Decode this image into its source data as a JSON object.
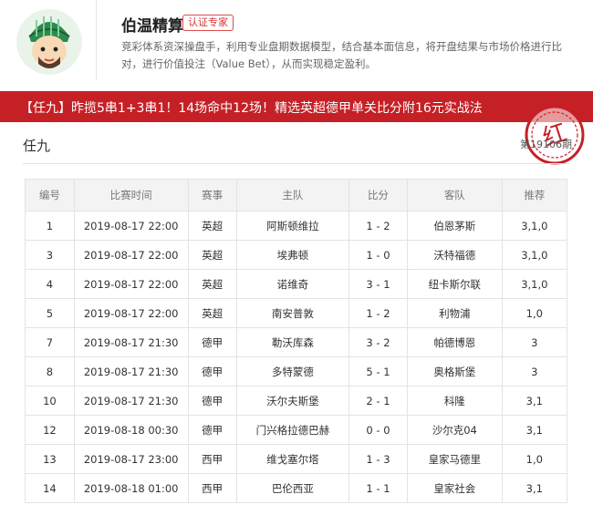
{
  "expert": {
    "name": "伯温精算",
    "badge": "认证专家",
    "description": "竞彩体系资深操盘手，利用专业盘期数据模型，结合基本面信息，将开盘结果与市场价格进行比对，进行价值投注（Value Bet），从而实现稳定盈利。"
  },
  "banner": {
    "title": "【任九】昨揽5串1+3串1！14场命中12场！精选英超德甲单关比分附16元实战法"
  },
  "stamp": {
    "text": "红"
  },
  "section": {
    "title": "任九",
    "issue": "第19106期"
  },
  "table": {
    "headers": [
      "编号",
      "比赛时间",
      "赛事",
      "主队",
      "比分",
      "客队",
      "推荐"
    ],
    "rows": [
      [
        "1",
        "2019-08-17 22:00",
        "英超",
        "阿斯顿维拉",
        "1 - 2",
        "伯恩茅斯",
        "3,1,0"
      ],
      [
        "3",
        "2019-08-17 22:00",
        "英超",
        "埃弗顿",
        "1 - 0",
        "沃特福德",
        "3,1,0"
      ],
      [
        "4",
        "2019-08-17 22:00",
        "英超",
        "诺维奇",
        "3 - 1",
        "纽卡斯尔联",
        "3,1,0"
      ],
      [
        "5",
        "2019-08-17 22:00",
        "英超",
        "南安普敦",
        "1 - 2",
        "利物浦",
        "1,0"
      ],
      [
        "7",
        "2019-08-17 21:30",
        "德甲",
        "勒沃库森",
        "3 - 2",
        "帕德博恩",
        "3"
      ],
      [
        "8",
        "2019-08-17 21:30",
        "德甲",
        "多特蒙德",
        "5 - 1",
        "奥格斯堡",
        "3"
      ],
      [
        "10",
        "2019-08-17 21:30",
        "德甲",
        "沃尔夫斯堡",
        "2 - 1",
        "科隆",
        "3,1"
      ],
      [
        "12",
        "2019-08-18 00:30",
        "德甲",
        "门兴格拉德巴赫",
        "0 - 0",
        "沙尔克04",
        "3,1"
      ],
      [
        "13",
        "2019-08-17 23:00",
        "西甲",
        "维戈塞尔塔",
        "1 - 3",
        "皇家马德里",
        "1,0"
      ],
      [
        "14",
        "2019-08-18 01:00",
        "西甲",
        "巴伦西亚",
        "1 - 1",
        "皇家社会",
        "3,1"
      ]
    ]
  },
  "colors": {
    "accent": "#c52026",
    "badge": "#d8363a"
  }
}
